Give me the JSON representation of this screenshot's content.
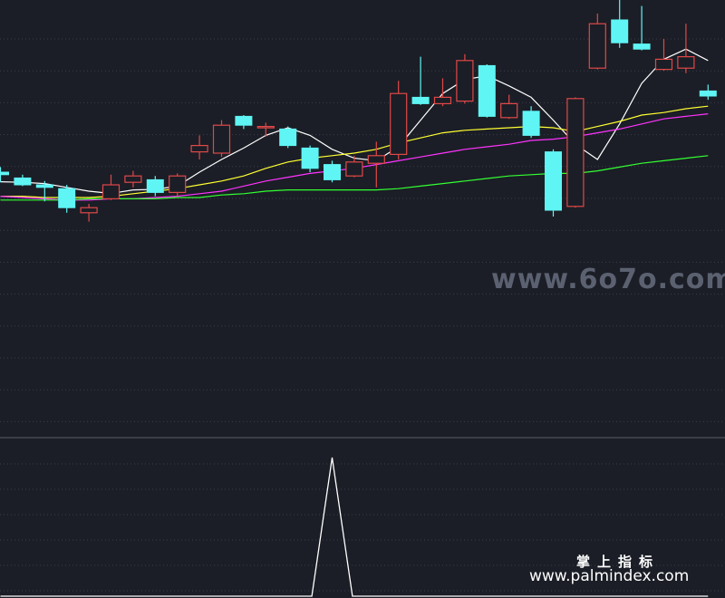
{
  "colors": {
    "background": "#1b1e26",
    "grid": "#3a3f4d",
    "panel_divider": "#5a5f6b",
    "up_candle": "#e04848",
    "down_candle": "#5ff5f5",
    "ma5": "#ffffff",
    "ma10": "#ffff33",
    "ma20": "#ff33ff",
    "ma60": "#33ff33",
    "indicator": "#ffffff"
  },
  "watermarks": {
    "center": "www.6o7o.com",
    "title": "掌上指标",
    "url": "www.palmindex.com"
  },
  "chart_data": [
    {
      "type": "candlestick",
      "panel": "price",
      "grid": true,
      "ylim": [
        0,
        100
      ],
      "candles": [
        {
          "o": 50.0,
          "c": 49.0,
          "h": 52.0,
          "l": 46.0
        },
        {
          "o": 47.7,
          "c": 45.0,
          "h": 49.0,
          "l": 44.5
        },
        {
          "o": 45.0,
          "c": 44.0,
          "h": 46.5,
          "l": 38.5
        },
        {
          "o": 43.5,
          "c": 36.0,
          "h": 45.0,
          "l": 34.0
        },
        {
          "o": 34.0,
          "c": 36.0,
          "h": 37.5,
          "l": 30.5
        },
        {
          "o": 39.5,
          "c": 45.0,
          "h": 49.0,
          "l": 39.0
        },
        {
          "o": 46.0,
          "c": 48.5,
          "h": 50.5,
          "l": 44.0
        },
        {
          "o": 47.0,
          "c": 42.0,
          "h": 48.5,
          "l": 40.5
        },
        {
          "o": 42.0,
          "c": 48.5,
          "h": 49.5,
          "l": 40.5
        },
        {
          "o": 58.0,
          "c": 60.5,
          "h": 64.5,
          "l": 55.0
        },
        {
          "o": 57.5,
          "c": 68.5,
          "h": 70.5,
          "l": 56.0
        },
        {
          "o": 72.0,
          "c": 68.5,
          "h": 72.5,
          "l": 67.0
        },
        {
          "o": 67.5,
          "c": 68.0,
          "h": 69.5,
          "l": 64.0
        },
        {
          "o": 67.0,
          "c": 60.5,
          "h": 68.0,
          "l": 59.5
        },
        {
          "o": 59.5,
          "c": 51.5,
          "h": 60.5,
          "l": 50.0
        },
        {
          "o": 53.0,
          "c": 47.0,
          "h": 54.5,
          "l": 46.0
        },
        {
          "o": 48.5,
          "c": 54.0,
          "h": 56.5,
          "l": 48.0
        },
        {
          "o": 53.5,
          "c": 56.5,
          "h": 62.0,
          "l": 44.0
        },
        {
          "o": 57.0,
          "c": 81.0,
          "h": 86.0,
          "l": 55.0
        },
        {
          "o": 79.5,
          "c": 77.0,
          "h": 95.5,
          "l": 76.5
        },
        {
          "o": 77.0,
          "c": 79.5,
          "h": 87.0,
          "l": 76.0
        },
        {
          "o": 78.0,
          "c": 94.0,
          "h": 96.5,
          "l": 77.0
        },
        {
          "o": 92.0,
          "c": 72.0,
          "h": 92.5,
          "l": 71.5
        },
        {
          "o": 71.5,
          "c": 77.0,
          "h": 80.5,
          "l": 71.0
        },
        {
          "o": 74.0,
          "c": 64.5,
          "h": 76.0,
          "l": 63.5
        },
        {
          "o": 58.0,
          "c": 35.0,
          "h": 59.0,
          "l": 32.5
        },
        {
          "o": 36.5,
          "c": 79.0,
          "h": 79.5,
          "l": 36.0
        },
        {
          "o": 91.0,
          "c": 108.5,
          "h": 112.5,
          "l": 90.5
        },
        {
          "o": 110.0,
          "c": 101.0,
          "h": 119.0,
          "l": 99.0
        },
        {
          "o": 100.5,
          "c": 98.5,
          "h": 115.5,
          "l": 98.0
        },
        {
          "o": 90.5,
          "c": 94.5,
          "h": 102.5,
          "l": 90.0
        },
        {
          "o": 91.0,
          "c": 95.5,
          "h": 108.5,
          "l": 89.0
        },
        {
          "o": 82.0,
          "c": 80.0,
          "h": 84.5,
          "l": 78.5
        }
      ],
      "series": [
        {
          "values": [
            46.2,
            46.0,
            45.5,
            44.0,
            42.5,
            41.6,
            43.0,
            43.2,
            44.5,
            50.0,
            55.0,
            59.5,
            64.5,
            67.5,
            64.5,
            59.0,
            55.5,
            54.5,
            60.0,
            70.5,
            81.0,
            86.5,
            88.0,
            84.0,
            79.5,
            70.5,
            61.0,
            55.0,
            69.0,
            85.0,
            94.5,
            98.5,
            94.0
          ]
        },
        {
          "values": [
            40.5,
            40.5,
            40.0,
            40.0,
            40.0,
            40.5,
            41.5,
            42.5,
            43.5,
            45.0,
            46.5,
            48.5,
            51.5,
            54.0,
            55.5,
            56.5,
            57.5,
            59.0,
            61.5,
            63.5,
            65.5,
            66.5,
            67.0,
            67.5,
            68.0,
            67.5,
            66.0,
            68.0,
            70.0,
            72.5,
            73.5,
            75.0,
            76.0
          ]
        },
        {
          "values": [
            40.5,
            40.0,
            39.5,
            39.0,
            39.0,
            39.5,
            39.5,
            40.0,
            40.5,
            41.5,
            42.5,
            44.5,
            46.5,
            48.0,
            49.5,
            50.5,
            51.5,
            53.0,
            54.5,
            56.0,
            57.5,
            59.0,
            60.0,
            61.0,
            62.5,
            63.0,
            64.0,
            65.5,
            67.0,
            69.0,
            71.0,
            72.0,
            73.0
          ]
        },
        {
          "values": [
            39.0,
            39.0,
            39.0,
            39.0,
            39.5,
            39.5,
            39.5,
            39.5,
            40.0,
            40.0,
            41.0,
            41.5,
            42.5,
            43.0,
            43.0,
            43.0,
            43.0,
            43.0,
            43.5,
            44.5,
            45.5,
            46.5,
            47.5,
            48.5,
            49.0,
            49.5,
            49.5,
            50.5,
            52.0,
            53.5,
            54.5,
            55.5,
            56.5
          ]
        }
      ]
    },
    {
      "type": "line",
      "panel": "indicator",
      "grid": true,
      "ylim": [
        0,
        1
      ],
      "series": [
        {
          "values": [
            0,
            0,
            0,
            0,
            0,
            0,
            0,
            0,
            0,
            0,
            0,
            0,
            0,
            0,
            0,
            1,
            0,
            0,
            0,
            0,
            0,
            0,
            0,
            0,
            0,
            0,
            0,
            0,
            0,
            0,
            0,
            0,
            0
          ]
        }
      ]
    }
  ]
}
